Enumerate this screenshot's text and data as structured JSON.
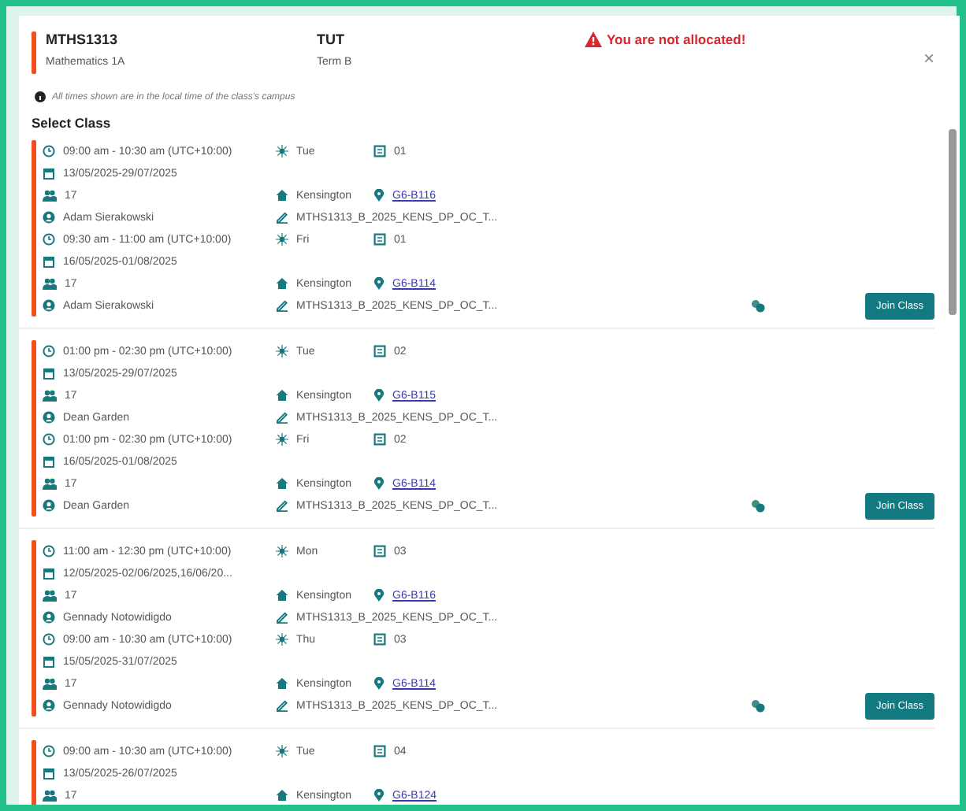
{
  "header": {
    "code": "MTHS1313",
    "name": "Mathematics 1A",
    "type": "TUT",
    "term": "Term B",
    "warning": "You are not allocated!",
    "close": "×"
  },
  "note": "All times shown are in the local time of the class's campus",
  "section_title": "Select Class",
  "groups": [
    {
      "join_button": "Join Class",
      "sessions": [
        {
          "time": "09:00 am - 10:30 am (UTC+10:00)",
          "day": "Tue",
          "week": "01",
          "dates": "13/05/2025-29/07/2025",
          "capacity": "17",
          "campus": "Kensington",
          "room": "G6-B116",
          "teacher": "Adam Sierakowski",
          "section": "MTHS1313_B_2025_KENS_DP_OC_T..."
        },
        {
          "time": "09:30 am - 11:00 am (UTC+10:00)",
          "day": "Fri",
          "week": "01",
          "dates": "16/05/2025-01/08/2025",
          "capacity": "17",
          "campus": "Kensington",
          "room": "G6-B114",
          "teacher": "Adam Sierakowski",
          "section": "MTHS1313_B_2025_KENS_DP_OC_T..."
        }
      ]
    },
    {
      "join_button": "Join Class",
      "sessions": [
        {
          "time": "01:00 pm - 02:30 pm (UTC+10:00)",
          "day": "Tue",
          "week": "02",
          "dates": "13/05/2025-29/07/2025",
          "capacity": "17",
          "campus": "Kensington",
          "room": "G6-B115",
          "teacher": "Dean Garden",
          "section": "MTHS1313_B_2025_KENS_DP_OC_T..."
        },
        {
          "time": "01:00 pm - 02:30 pm (UTC+10:00)",
          "day": "Fri",
          "week": "02",
          "dates": "16/05/2025-01/08/2025",
          "capacity": "17",
          "campus": "Kensington",
          "room": "G6-B114",
          "teacher": "Dean Garden",
          "section": "MTHS1313_B_2025_KENS_DP_OC_T..."
        }
      ]
    },
    {
      "join_button": "Join Class",
      "sessions": [
        {
          "time": "11:00 am - 12:30 pm (UTC+10:00)",
          "day": "Mon",
          "week": "03",
          "dates": "12/05/2025-02/06/2025,16/06/20...",
          "capacity": "17",
          "campus": "Kensington",
          "room": "G6-B116",
          "teacher": "Gennady Notowidigdo",
          "section": "MTHS1313_B_2025_KENS_DP_OC_T..."
        },
        {
          "time": "09:00 am - 10:30 am (UTC+10:00)",
          "day": "Thu",
          "week": "03",
          "dates": "15/05/2025-31/07/2025",
          "capacity": "17",
          "campus": "Kensington",
          "room": "G6-B114",
          "teacher": "Gennady Notowidigdo",
          "section": "MTHS1313_B_2025_KENS_DP_OC_T..."
        }
      ]
    },
    {
      "sessions": [
        {
          "time": "09:00 am - 10:30 am (UTC+10:00)",
          "day": "Tue",
          "week": "04",
          "dates": "13/05/2025-26/07/2025",
          "capacity": "17",
          "campus": "Kensington",
          "room": "G6-B124"
        }
      ]
    }
  ]
}
